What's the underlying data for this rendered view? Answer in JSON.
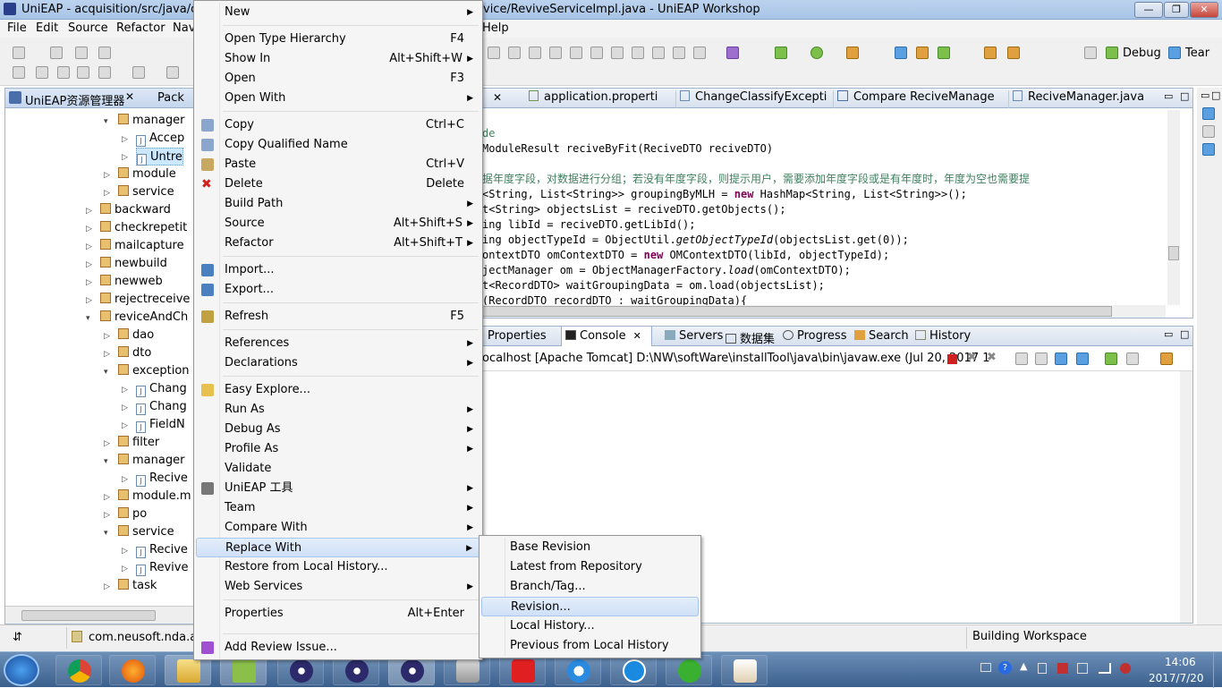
{
  "window": {
    "title_left": "UniEAP - acquisition/src/java/com",
    "title_right": "vice/ReviveServiceImpl.java - UniEAP Workshop",
    "help_tail": "Help"
  },
  "menubar": [
    "File",
    "Edit",
    "Source",
    "Refactor",
    "Nav"
  ],
  "toolbar": {
    "debug_label": "Debug",
    "team_label": "Tear"
  },
  "left_panel": {
    "tab_label": "UniEAP资源管理器",
    "tab2_label": "Pack",
    "tree": [
      {
        "label": "manager",
        "icon": "package-icon"
      },
      {
        "label": "Accep",
        "icon": "java-file-icon"
      },
      {
        "label": "Untre",
        "icon": "java-file-icon"
      },
      {
        "label": "module",
        "icon": "package-icon"
      },
      {
        "label": "service",
        "icon": "package-icon"
      },
      {
        "label": "backward",
        "icon": "package-icon"
      },
      {
        "label": "checkrepetit",
        "icon": "package-icon"
      },
      {
        "label": "mailcapture",
        "icon": "package-icon"
      },
      {
        "label": "newbuild",
        "icon": "package-icon"
      },
      {
        "label": "newweb",
        "icon": "package-icon"
      },
      {
        "label": "rejectreceive",
        "icon": "package-icon"
      },
      {
        "label": "reviceAndCh",
        "icon": "package-icon"
      },
      {
        "label": "dao",
        "icon": "package-icon"
      },
      {
        "label": "dto",
        "icon": "package-icon"
      },
      {
        "label": "exception",
        "icon": "package-icon"
      },
      {
        "label": "Chang",
        "icon": "java-file-icon"
      },
      {
        "label": "Chang",
        "icon": "java-file-icon"
      },
      {
        "label": "FieldN",
        "icon": "java-file-icon"
      },
      {
        "label": "filter",
        "icon": "package-icon"
      },
      {
        "label": "manager",
        "icon": "package-icon"
      },
      {
        "label": "Recive",
        "icon": "java-file-icon"
      },
      {
        "label": "module.m",
        "icon": "package-icon"
      },
      {
        "label": "po",
        "icon": "package-icon"
      },
      {
        "label": "service",
        "icon": "package-icon"
      },
      {
        "label": "Recive",
        "icon": "java-file-icon"
      },
      {
        "label": "Revive",
        "icon": "java-file-icon"
      },
      {
        "label": "task",
        "icon": "package-icon"
      }
    ]
  },
  "editor": {
    "tabs": [
      "application.properti",
      "ChangeClassifyExcepti",
      "Compare ReciveManage",
      "ReciveManager.java"
    ],
    "lines": [
      {
        "a": "de",
        "b": "",
        "c": "",
        "k": ""
      },
      {
        "a": "ModuleResult reciveByFit(ReciveDTO reciveDTO)",
        "b": "",
        "c": "",
        "k": ""
      },
      {
        "a": "",
        "b": "",
        "c": "",
        "k": ""
      },
      {
        "a": "据年度字段，对数据进行分组；若没有年度字段，则提示用户，需要添加年度字段或是有年度时，年度为空也需要提",
        "b": "",
        "c": "",
        "k": "comment"
      },
      {
        "a": "<String, List<String>> groupingByMLH = ",
        "k": "new",
        "b": " HashMap<String, List<String>>();",
        "c": ""
      },
      {
        "a": "t<String> objectsList = reciveDTO.getObjects();",
        "b": "",
        "c": "",
        "k": ""
      },
      {
        "a": "ing libId = reciveDTO.getLibId();",
        "b": "",
        "c": "",
        "k": ""
      },
      {
        "a": "ing objectTypeId = ObjectUtil.",
        "it": "getObjectTypeId",
        "b": "(objectsList.get(0));",
        "c": "",
        "k": ""
      },
      {
        "a": "ontextDTO omContextDTO = ",
        "k": "new",
        "b": " OMContextDTO(libId, objectTypeId);",
        "c": ""
      },
      {
        "a": "jectManager om = ObjectManagerFactory.",
        "it": "load",
        "b": "(omContextDTO);",
        "c": "",
        "k": ""
      },
      {
        "a": "t<RecordDTO> waitGroupingData = om.load(objectsList);",
        "b": "",
        "c": "",
        "k": ""
      },
      {
        "a": "(RecordDTO recordDTO : waitGroupingData){",
        "b": "",
        "c": "",
        "k": ""
      }
    ]
  },
  "console": {
    "tabs": [
      "Properties",
      "Console",
      "Servers",
      "数据集",
      "Progress",
      "Search",
      "History"
    ],
    "header": "ocalhost [Apache Tomcat] D:\\NW\\softWare\\installTool\\java\\bin\\javaw.exe (Jul 20, 2017 1"
  },
  "status": {
    "left": "com.neusoft.nda.acq",
    "right": "Building Workspace"
  },
  "context_menu": [
    {
      "label": "New",
      "shortcut": "",
      "submenu": true,
      "icon": "",
      "sep_before": false
    },
    {
      "label": "Open Type Hierarchy",
      "shortcut": "F4",
      "submenu": false,
      "icon": "",
      "sep_before": true
    },
    {
      "label": "Show In",
      "shortcut": "Alt+Shift+W",
      "submenu": true,
      "icon": "",
      "sep_before": false
    },
    {
      "label": "Open",
      "shortcut": "F3",
      "submenu": false,
      "icon": "",
      "sep_before": false
    },
    {
      "label": "Open With",
      "shortcut": "",
      "submenu": true,
      "icon": "",
      "sep_before": false
    },
    {
      "label": "Copy",
      "shortcut": "Ctrl+C",
      "submenu": false,
      "icon": "copy-icon",
      "sep_before": true
    },
    {
      "label": "Copy Qualified Name",
      "shortcut": "",
      "submenu": false,
      "icon": "copy-qualified-icon",
      "sep_before": false
    },
    {
      "label": "Paste",
      "shortcut": "Ctrl+V",
      "submenu": false,
      "icon": "paste-icon",
      "sep_before": false
    },
    {
      "label": "Delete",
      "shortcut": "Delete",
      "submenu": false,
      "icon": "delete-icon",
      "sep_before": false
    },
    {
      "label": "Build Path",
      "shortcut": "",
      "submenu": true,
      "icon": "",
      "sep_before": false
    },
    {
      "label": "Source",
      "shortcut": "Alt+Shift+S",
      "submenu": true,
      "icon": "",
      "sep_before": false
    },
    {
      "label": "Refactor",
      "shortcut": "Alt+Shift+T",
      "submenu": true,
      "icon": "",
      "sep_before": false
    },
    {
      "label": "Import...",
      "shortcut": "",
      "submenu": false,
      "icon": "import-icon",
      "sep_before": true
    },
    {
      "label": "Export...",
      "shortcut": "",
      "submenu": false,
      "icon": "export-icon",
      "sep_before": false
    },
    {
      "label": "Refresh",
      "shortcut": "F5",
      "submenu": false,
      "icon": "refresh-icon",
      "sep_before": true
    },
    {
      "label": "References",
      "shortcut": "",
      "submenu": true,
      "icon": "",
      "sep_before": true
    },
    {
      "label": "Declarations",
      "shortcut": "",
      "submenu": true,
      "icon": "",
      "sep_before": false
    },
    {
      "label": "Easy Explore...",
      "shortcut": "",
      "submenu": false,
      "icon": "folder-icon",
      "sep_before": true
    },
    {
      "label": "Run As",
      "shortcut": "",
      "submenu": true,
      "icon": "",
      "sep_before": false
    },
    {
      "label": "Debug As",
      "shortcut": "",
      "submenu": true,
      "icon": "",
      "sep_before": false
    },
    {
      "label": "Profile As",
      "shortcut": "",
      "submenu": true,
      "icon": "",
      "sep_before": false
    },
    {
      "label": "Validate",
      "shortcut": "",
      "submenu": false,
      "icon": "",
      "sep_before": false
    },
    {
      "label": "UniEAP 工具",
      "shortcut": "",
      "submenu": true,
      "icon": "tools-icon",
      "sep_before": false
    },
    {
      "label": "Team",
      "shortcut": "",
      "submenu": true,
      "icon": "",
      "sep_before": false
    },
    {
      "label": "Compare With",
      "shortcut": "",
      "submenu": true,
      "icon": "",
      "sep_before": false
    },
    {
      "label": "Replace With",
      "shortcut": "",
      "submenu": true,
      "icon": "",
      "sep_before": false,
      "highlight": true
    },
    {
      "label": "Restore from Local History...",
      "shortcut": "",
      "submenu": false,
      "icon": "",
      "sep_before": false
    },
    {
      "label": "Web Services",
      "shortcut": "",
      "submenu": true,
      "icon": "",
      "sep_before": false
    },
    {
      "label": "Properties",
      "shortcut": "Alt+Enter",
      "submenu": false,
      "icon": "",
      "sep_before": true
    },
    {
      "label": "Add Review Issue...",
      "shortcut": "",
      "submenu": false,
      "icon": "review-icon",
      "sep_before": true
    }
  ],
  "replace_submenu": [
    {
      "label": "Base Revision"
    },
    {
      "label": "Latest from Repository"
    },
    {
      "label": "Branch/Tag..."
    },
    {
      "label": "Revision...",
      "highlight": true
    },
    {
      "label": "Local History..."
    },
    {
      "label": "Previous from Local History"
    }
  ],
  "taskbar": {
    "apps": [
      "chrome",
      "firefox",
      "explorer",
      "notepad",
      "eclipse",
      "eclipse",
      "eclipse",
      "database",
      "youdao",
      "baiduyun",
      "kuaiya",
      "wechat",
      "java-cup"
    ],
    "time": "14:06",
    "date": "2017/7/20"
  },
  "colors": {
    "accent": "#3399ff",
    "menu_highlight": "#cfe0f6",
    "keyword": "#7f0055",
    "comment": "#3f7f5f"
  }
}
